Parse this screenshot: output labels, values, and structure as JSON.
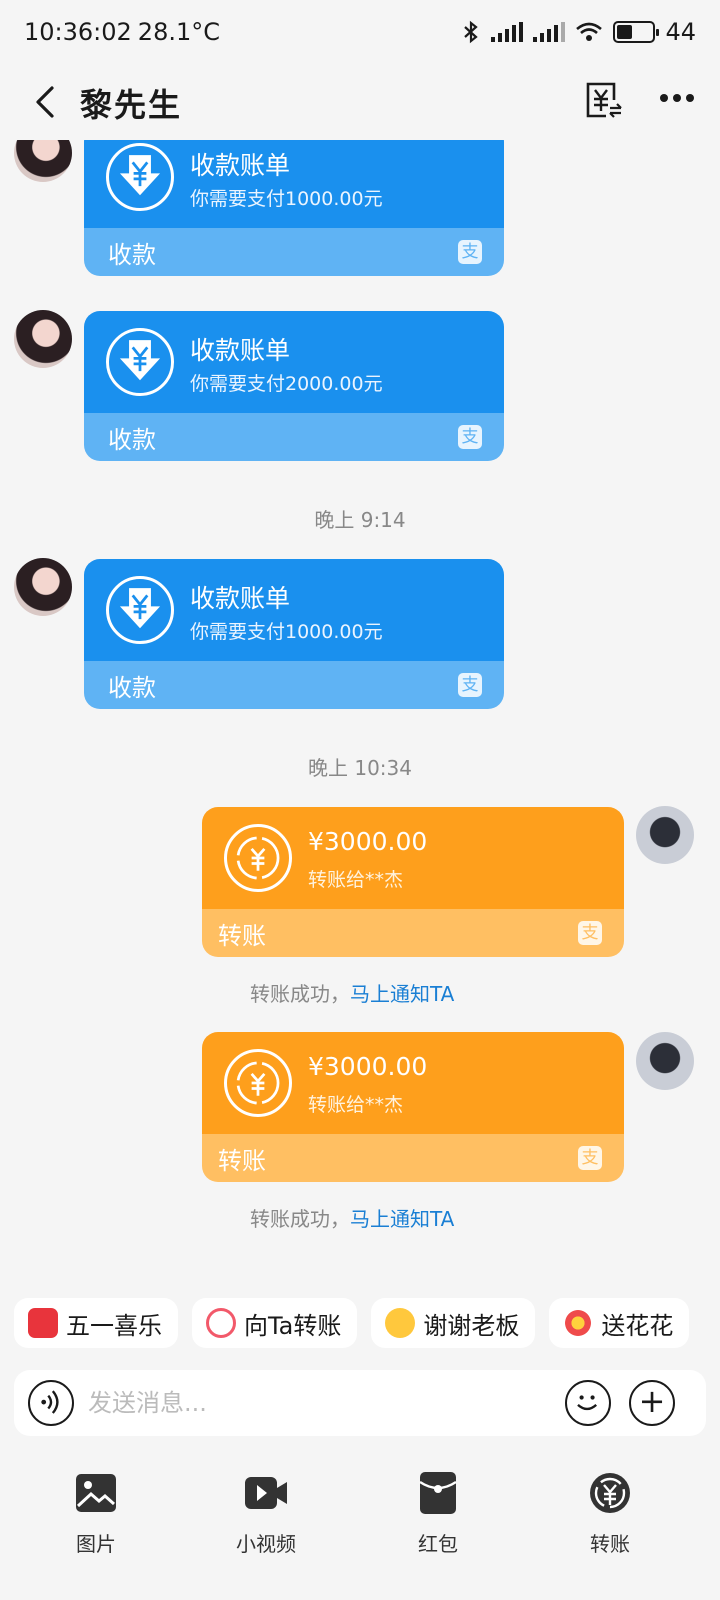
{
  "status": {
    "time": "10:36:02",
    "temp": "28.1°C",
    "battery": "44",
    "battery_level": 0.44
  },
  "header": {
    "title": "黎先生"
  },
  "messages": {
    "bill_1": {
      "title": "收款账单",
      "subtitle": "你需要支付1000.00元",
      "footer": "收款"
    },
    "bill_2": {
      "title": "收款账单",
      "subtitle": "你需要支付2000.00元",
      "footer": "收款"
    },
    "time_1": "晚上 9:14",
    "bill_3": {
      "title": "收款账单",
      "subtitle": "你需要支付1000.00元",
      "footer": "收款"
    },
    "time_2": "晚上 10:34",
    "transfer_1": {
      "amount": "¥3000.00",
      "to": "转账给**杰",
      "footer": "转账"
    },
    "notice_1": {
      "text": "转账成功，",
      "link": "马上通知TA"
    },
    "transfer_2": {
      "amount": "¥3000.00",
      "to": "转账给**杰",
      "footer": "转账"
    },
    "notice_2": {
      "text": "转账成功，",
      "link": "马上通知TA"
    }
  },
  "quick_actions": [
    "五一喜乐",
    "向Ta转账",
    "谢谢老板",
    "送花花"
  ],
  "input": {
    "placeholder": "发送消息..."
  },
  "toolbar": [
    "图片",
    "小视频",
    "红包",
    "转账"
  ],
  "colors": {
    "blue_card": "#1a90ee",
    "blue_footer": "#5fb3f4",
    "orange_card": "#fe9f1c",
    "orange_footer": "#ffbf62",
    "link": "#1a7fd4"
  }
}
